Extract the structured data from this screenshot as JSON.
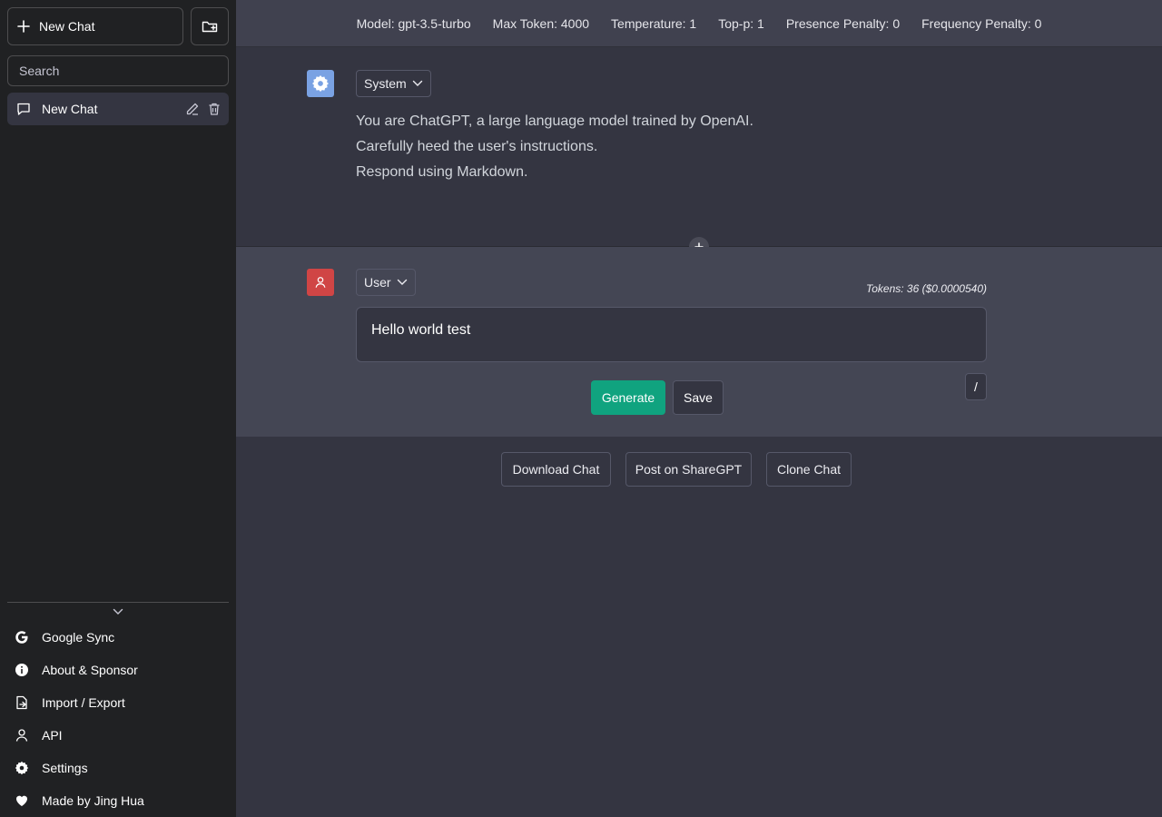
{
  "sidebar": {
    "new_chat_label": "New Chat",
    "search_placeholder": "Search",
    "chats": [
      {
        "title": "New Chat"
      }
    ],
    "menu": [
      {
        "label": "Google Sync",
        "icon": "google-icon"
      },
      {
        "label": "About & Sponsor",
        "icon": "info-icon"
      },
      {
        "label": "Import / Export",
        "icon": "import-export-icon"
      },
      {
        "label": "API",
        "icon": "person-icon"
      },
      {
        "label": "Settings",
        "icon": "gear-icon"
      },
      {
        "label": "Made by Jing Hua",
        "icon": "heart-icon"
      }
    ]
  },
  "config": {
    "model": "Model: gpt-3.5-turbo",
    "max_token": "Max Token: 4000",
    "temperature": "Temperature: 1",
    "top_p": "Top-p: 1",
    "presence_penalty": "Presence Penalty: 0",
    "frequency_penalty": "Frequency Penalty: 0"
  },
  "system_message": {
    "role": "System",
    "lines": [
      "You are ChatGPT, a large language model trained by OpenAI.",
      "Carefully heed the user's instructions.",
      "Respond using Markdown."
    ]
  },
  "user_message": {
    "role": "User",
    "tokens": "Tokens: 36 ($0.0000540)",
    "content": "Hello world test",
    "generate_label": "Generate",
    "save_label": "Save",
    "command_label": "/"
  },
  "actions": {
    "download": "Download Chat",
    "share": "Post on ShareGPT",
    "clone": "Clone Chat"
  },
  "colors": {
    "sidebar_bg": "#202123",
    "main_bg": "#343541",
    "user_bg": "#444654",
    "accent_green": "#10a37f",
    "system_avatar": "#7aa2e3",
    "user_avatar": "#d04545"
  }
}
